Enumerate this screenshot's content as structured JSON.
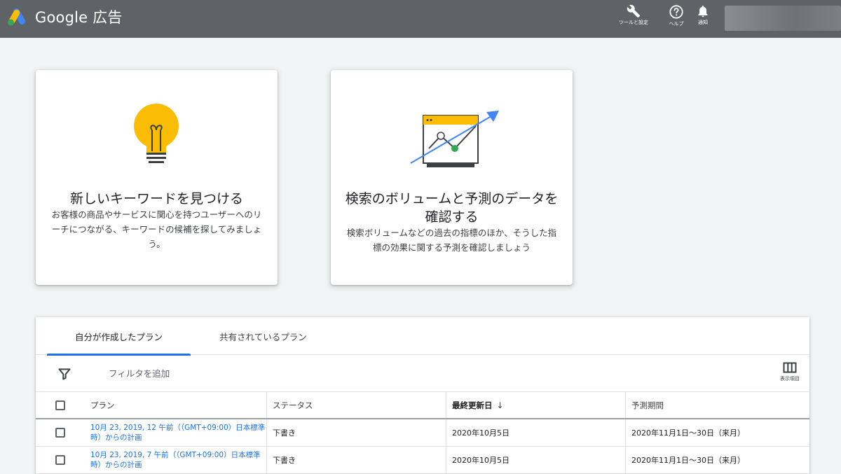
{
  "header": {
    "brand": "Google 広告",
    "tools_label": "ツールと設定",
    "help_label": "ヘルプ",
    "notifications_label": "通知",
    "colors": {
      "bar": "#5f6368",
      "logo_blue": "#4285f4",
      "logo_yellow": "#fbbc04",
      "logo_green": "#34a853"
    }
  },
  "cards": [
    {
      "title": "新しいキーワードを見つける",
      "description": "お客様の商品やサービスに関心を持つユーザーへのリーチにつながる、キーワードの候補を探してみましょう。",
      "icon": "lightbulb-icon"
    },
    {
      "title": "検索のボリュームと予測のデータを確認する",
      "description": "検索ボリュームなどの過去の指標のほか、そうした指標の効果に関する予測を確認しましょう",
      "icon": "forecast-chart-icon"
    }
  ],
  "tabs": [
    {
      "label": "自分が作成したプラン",
      "active": true
    },
    {
      "label": "共有されているプラン",
      "active": false
    }
  ],
  "filter": {
    "add_label": "フィルタを追加",
    "columns_label": "表示項目"
  },
  "table": {
    "headers": {
      "plan": "プラン",
      "status": "ステータス",
      "updated": "最終更新日",
      "updated_sort": "↓",
      "period": "予測期間"
    },
    "rows": [
      {
        "plan": "10月 23, 2019, 12 午前（（GMT+09:00）日本標準時）からの計画",
        "status": "下書き",
        "updated": "2020年10月5日",
        "period": "2020年11月1日〜30日（来月）"
      },
      {
        "plan": "10月 23, 2019, 7 午前（（GMT+09:00）日本標準時）からの計画",
        "status": "下書き",
        "updated": "2020年10月5日",
        "period": "2020年11月1日〜30日（来月）"
      }
    ]
  }
}
